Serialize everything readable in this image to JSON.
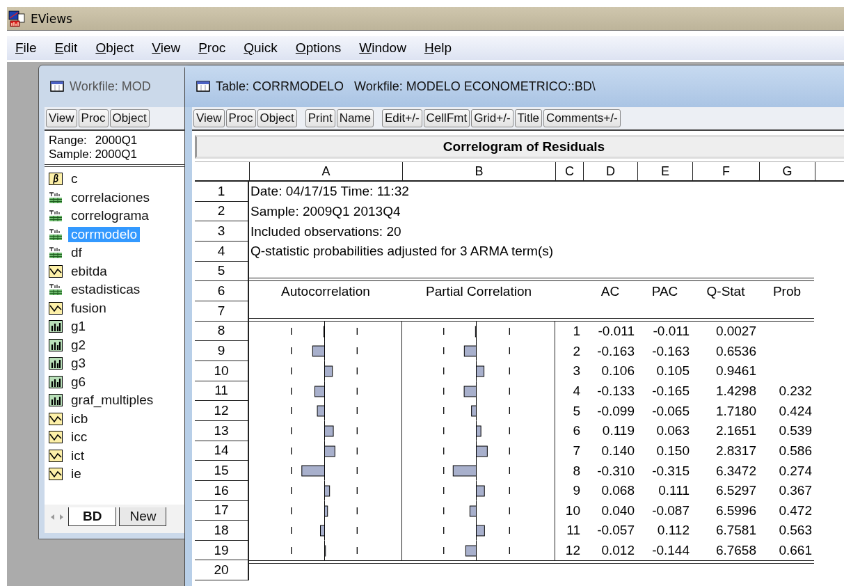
{
  "app_window": {
    "title": "EViews"
  },
  "menu_bar": [
    "File",
    "Edit",
    "Object",
    "View",
    "Proc",
    "Quick",
    "Options",
    "Window",
    "Help"
  ],
  "workfile_window": {
    "title": "Workfile: MOD",
    "buttons": [
      "View",
      "Proc",
      "Object"
    ],
    "range_label": "Range:",
    "range_value": "2000Q1",
    "sample_label": "Sample:",
    "sample_value": "2000Q1",
    "objects": [
      {
        "kind": "coef",
        "name": "c",
        "selected": false
      },
      {
        "kind": "table",
        "name": "correlaciones",
        "selected": false
      },
      {
        "kind": "table",
        "name": "correlograma",
        "selected": false
      },
      {
        "kind": "table",
        "name": "corrmodelo",
        "selected": true
      },
      {
        "kind": "table",
        "name": "df",
        "selected": false
      },
      {
        "kind": "series",
        "name": "ebitda",
        "selected": false
      },
      {
        "kind": "table",
        "name": "estadisticas",
        "selected": false
      },
      {
        "kind": "series",
        "name": "fusion",
        "selected": false
      },
      {
        "kind": "graph",
        "name": "g1",
        "selected": false
      },
      {
        "kind": "graph",
        "name": "g2",
        "selected": false
      },
      {
        "kind": "graph",
        "name": "g3",
        "selected": false
      },
      {
        "kind": "graph",
        "name": "g6",
        "selected": false
      },
      {
        "kind": "graph",
        "name": "graf_multiples",
        "selected": false
      },
      {
        "kind": "series",
        "name": "icb",
        "selected": false
      },
      {
        "kind": "series",
        "name": "icc",
        "selected": false
      },
      {
        "kind": "series",
        "name": "ict",
        "selected": false
      },
      {
        "kind": "series",
        "name": "ie",
        "selected": false
      }
    ],
    "tabs": [
      {
        "label": "BD",
        "selected": true
      },
      {
        "label": "New",
        "selected": false
      }
    ]
  },
  "table_window": {
    "title": "Table: CORRMODELO   Workfile: MODELO ECONOMETRICO::BD\\",
    "toolbar_groups": [
      [
        "View",
        "Proc",
        "Object"
      ],
      [
        "Print",
        "Name"
      ],
      [
        "Edit+/-",
        "CellFmt",
        "Grid+/-",
        "Title",
        "Comments+/-"
      ]
    ],
    "table_title": "Correlogram of Residuals",
    "columns": [
      "A",
      "B",
      "C",
      "D",
      "E",
      "F",
      "G"
    ],
    "row_numbers": [
      "1",
      "2",
      "3",
      "4",
      "5",
      "6",
      "7",
      "8",
      "9",
      "10",
      "11",
      "12",
      "13",
      "14",
      "15",
      "16",
      "17",
      "18",
      "19",
      "20"
    ],
    "info_lines": [
      "Date: 04/17/15   Time: 11:32",
      "Sample: 2009Q1 2013Q4",
      "Included observations: 20",
      "Q-statistic probabilities adjusted for 3 ARMA term(s)"
    ],
    "correlogram": {
      "headers": {
        "autocorrelation": "Autocorrelation",
        "partial_correlation": "Partial Correlation",
        "ac": "AC",
        "pac": "PAC",
        "q_stat": "Q-Stat",
        "prob": "Prob"
      },
      "lags": [
        {
          "lag": "1",
          "ac": "-0.011",
          "pac": "-0.011",
          "q_stat": "0.0027"
        },
        {
          "lag": "2",
          "ac": "-0.163",
          "pac": "-0.163",
          "q_stat": "0.6536"
        },
        {
          "lag": "3",
          "ac": "0.106",
          "pac": "0.105",
          "q_stat": "0.9461"
        },
        {
          "lag": "4",
          "ac": "-0.133",
          "pac": "-0.165",
          "q_stat": "1.4298",
          "prob": "0.232"
        },
        {
          "lag": "5",
          "ac": "-0.099",
          "pac": "-0.065",
          "q_stat": "1.7180",
          "prob": "0.424"
        },
        {
          "lag": "6",
          "ac": "0.119",
          "pac": "0.063",
          "q_stat": "2.1651",
          "prob": "0.539"
        },
        {
          "lag": "7",
          "ac": "0.140",
          "pac": "0.150",
          "q_stat": "2.8317",
          "prob": "0.586"
        },
        {
          "lag": "8",
          "ac": "-0.310",
          "pac": "-0.315",
          "q_stat": "6.3472",
          "prob": "0.274"
        },
        {
          "lag": "9",
          "ac": "0.068",
          "pac": "0.111",
          "q_stat": "6.5297",
          "prob": "0.367"
        },
        {
          "lag": "10",
          "ac": "0.040",
          "pac": "-0.087",
          "q_stat": "6.5996",
          "prob": "0.472"
        },
        {
          "lag": "11",
          "ac": "-0.057",
          "pac": "0.112",
          "q_stat": "6.7581",
          "prob": "0.563"
        },
        {
          "lag": "12",
          "ac": "0.012",
          "pac": "-0.144",
          "q_stat": "6.7658",
          "prob": "0.661"
        }
      ]
    }
  }
}
